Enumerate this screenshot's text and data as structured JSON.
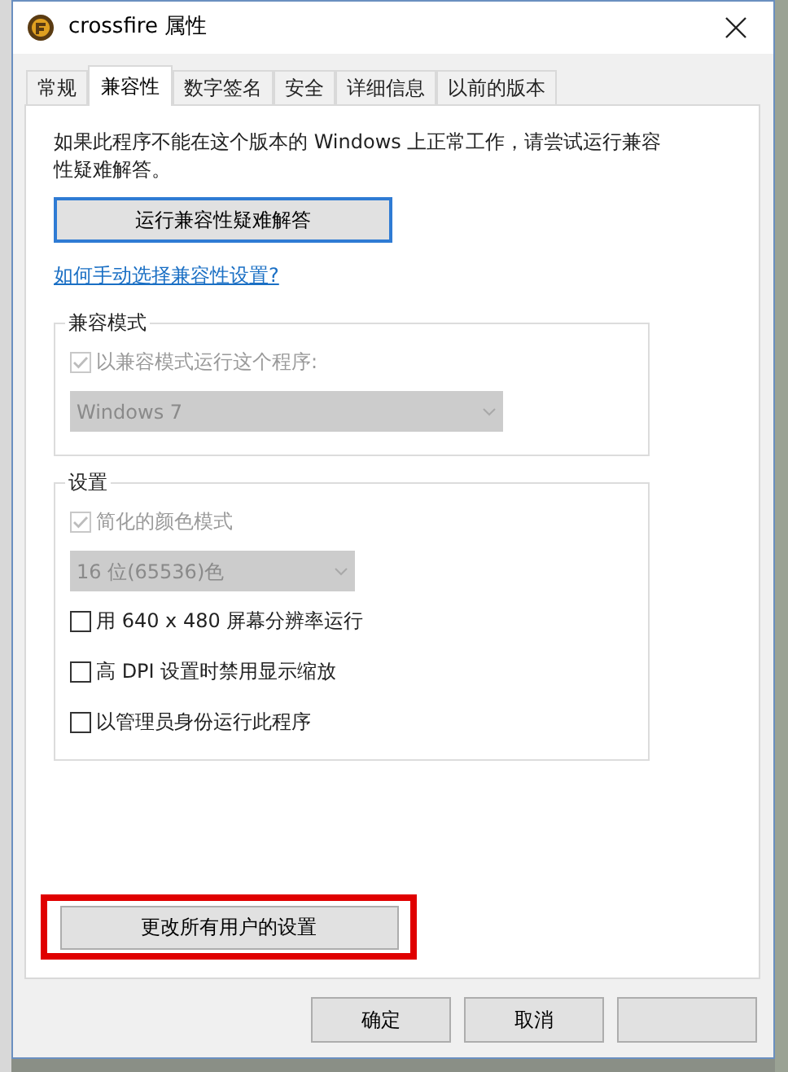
{
  "window": {
    "title": "crossfire 属性"
  },
  "tabs": [
    {
      "label": "常规",
      "selected": false
    },
    {
      "label": "兼容性",
      "selected": true
    },
    {
      "label": "数字签名",
      "selected": false
    },
    {
      "label": "安全",
      "selected": false
    },
    {
      "label": "详细信息",
      "selected": false
    },
    {
      "label": "以前的版本",
      "selected": false
    }
  ],
  "intro": "如果此程序不能在这个版本的 Windows 上正常工作，请尝试运行兼容性疑难解答。",
  "troubleshoot_button": "运行兼容性疑难解答",
  "help_link": "如何手动选择兼容性设置?",
  "groups": [
    {
      "title": "兼容模式",
      "items": [
        {
          "kind": "checkbox",
          "label": "以兼容模式运行这个程序:",
          "checked": true,
          "disabled": true
        },
        {
          "kind": "dropdown",
          "value": "Windows 7",
          "disabled": true,
          "wide": true
        }
      ]
    },
    {
      "title": "设置",
      "items": [
        {
          "kind": "checkbox",
          "label": "简化的颜色模式",
          "checked": true,
          "disabled": true
        },
        {
          "kind": "dropdown",
          "value": "16 位(65536)色",
          "disabled": true,
          "wide": false
        },
        {
          "kind": "checkbox",
          "label": "用 640 x 480 屏幕分辨率运行",
          "checked": false,
          "disabled": false
        },
        {
          "kind": "checkbox",
          "label": "高 DPI 设置时禁用显示缩放",
          "checked": false,
          "disabled": false
        },
        {
          "kind": "checkbox",
          "label": "以管理员身份运行此程序",
          "checked": false,
          "disabled": false
        }
      ]
    }
  ],
  "all_users_button": {
    "label": "更改所有用户的设置",
    "highlighted": true
  },
  "dialog_buttons": [
    {
      "kind": "labeled",
      "label": "确定"
    },
    {
      "kind": "labeled",
      "label": "取消"
    },
    {
      "kind": "blank"
    }
  ]
}
